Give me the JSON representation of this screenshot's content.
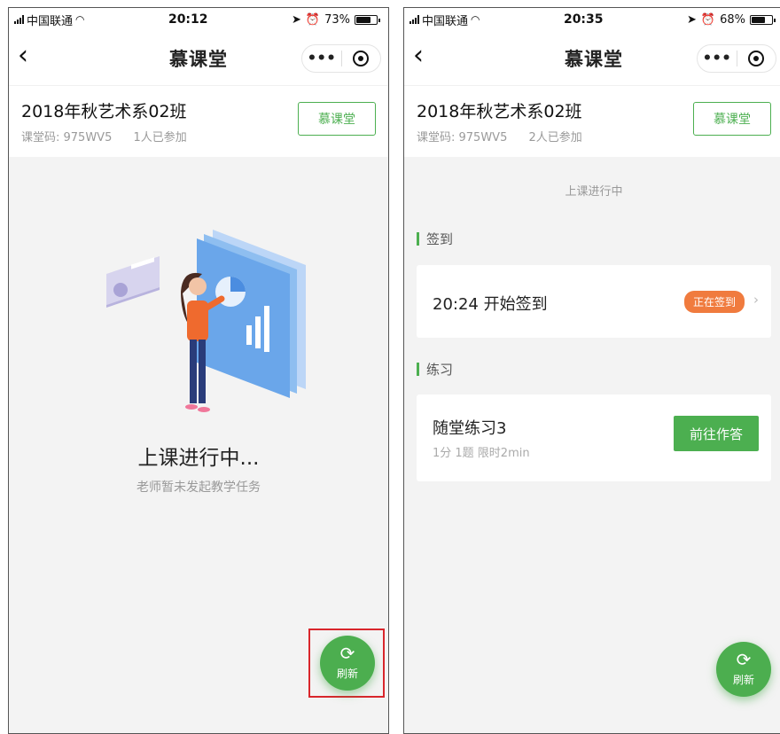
{
  "colors": {
    "accent": "#4caf50",
    "badge": "#f07b3e",
    "highlight": "#d9262c",
    "page_bg": "#f3f3f3"
  },
  "left": {
    "status": {
      "carrier": "中国联通",
      "time": "20:12",
      "battery": "73%",
      "battery_level": 0.73
    },
    "nav": {
      "title": "慕课堂"
    },
    "class": {
      "name": "2018年秋艺术系02班",
      "code": "课堂码: 975WV5",
      "participants": "1人已参加",
      "button": "慕课堂"
    },
    "empty": {
      "title": "上课进行中...",
      "subtitle": "老师暂未发起教学任务"
    },
    "refresh": {
      "icon": "refresh-icon",
      "label": "刷新"
    }
  },
  "right": {
    "status": {
      "carrier": "中国联通",
      "time": "20:35",
      "battery": "68%",
      "battery_level": 0.68
    },
    "nav": {
      "title": "慕课堂"
    },
    "class": {
      "name": "2018年秋艺术系02班",
      "code": "课堂码: 975WV5",
      "participants": "2人已参加",
      "button": "慕课堂"
    },
    "session_status": "上课进行中",
    "checkin": {
      "section": "签到",
      "title": "20:24 开始签到",
      "badge": "正在签到"
    },
    "practice": {
      "section": "练习",
      "title": "随堂练习3",
      "meta": "1分 1题 限时2min",
      "button": "前往作答"
    },
    "refresh": {
      "icon": "refresh-icon",
      "label": "刷新"
    }
  }
}
